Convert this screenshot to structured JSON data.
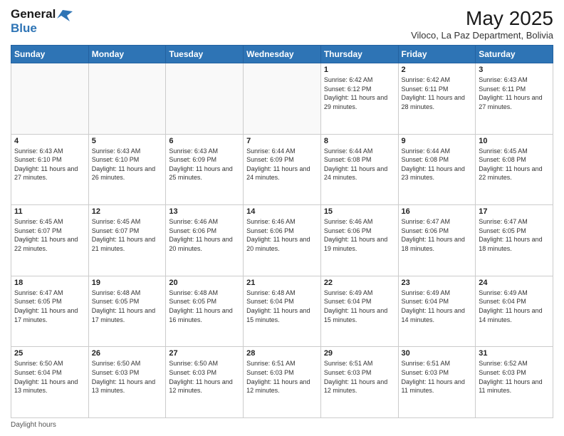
{
  "header": {
    "logo_line1": "General",
    "logo_line2": "Blue",
    "month": "May 2025",
    "location": "Viloco, La Paz Department, Bolivia"
  },
  "days_of_week": [
    "Sunday",
    "Monday",
    "Tuesday",
    "Wednesday",
    "Thursday",
    "Friday",
    "Saturday"
  ],
  "weeks": [
    [
      {
        "day": "",
        "info": ""
      },
      {
        "day": "",
        "info": ""
      },
      {
        "day": "",
        "info": ""
      },
      {
        "day": "",
        "info": ""
      },
      {
        "day": "1",
        "info": "Sunrise: 6:42 AM\nSunset: 6:12 PM\nDaylight: 11 hours and 29 minutes."
      },
      {
        "day": "2",
        "info": "Sunrise: 6:42 AM\nSunset: 6:11 PM\nDaylight: 11 hours and 28 minutes."
      },
      {
        "day": "3",
        "info": "Sunrise: 6:43 AM\nSunset: 6:11 PM\nDaylight: 11 hours and 27 minutes."
      }
    ],
    [
      {
        "day": "4",
        "info": "Sunrise: 6:43 AM\nSunset: 6:10 PM\nDaylight: 11 hours and 27 minutes."
      },
      {
        "day": "5",
        "info": "Sunrise: 6:43 AM\nSunset: 6:10 PM\nDaylight: 11 hours and 26 minutes."
      },
      {
        "day": "6",
        "info": "Sunrise: 6:43 AM\nSunset: 6:09 PM\nDaylight: 11 hours and 25 minutes."
      },
      {
        "day": "7",
        "info": "Sunrise: 6:44 AM\nSunset: 6:09 PM\nDaylight: 11 hours and 24 minutes."
      },
      {
        "day": "8",
        "info": "Sunrise: 6:44 AM\nSunset: 6:08 PM\nDaylight: 11 hours and 24 minutes."
      },
      {
        "day": "9",
        "info": "Sunrise: 6:44 AM\nSunset: 6:08 PM\nDaylight: 11 hours and 23 minutes."
      },
      {
        "day": "10",
        "info": "Sunrise: 6:45 AM\nSunset: 6:08 PM\nDaylight: 11 hours and 22 minutes."
      }
    ],
    [
      {
        "day": "11",
        "info": "Sunrise: 6:45 AM\nSunset: 6:07 PM\nDaylight: 11 hours and 22 minutes."
      },
      {
        "day": "12",
        "info": "Sunrise: 6:45 AM\nSunset: 6:07 PM\nDaylight: 11 hours and 21 minutes."
      },
      {
        "day": "13",
        "info": "Sunrise: 6:46 AM\nSunset: 6:06 PM\nDaylight: 11 hours and 20 minutes."
      },
      {
        "day": "14",
        "info": "Sunrise: 6:46 AM\nSunset: 6:06 PM\nDaylight: 11 hours and 20 minutes."
      },
      {
        "day": "15",
        "info": "Sunrise: 6:46 AM\nSunset: 6:06 PM\nDaylight: 11 hours and 19 minutes."
      },
      {
        "day": "16",
        "info": "Sunrise: 6:47 AM\nSunset: 6:06 PM\nDaylight: 11 hours and 18 minutes."
      },
      {
        "day": "17",
        "info": "Sunrise: 6:47 AM\nSunset: 6:05 PM\nDaylight: 11 hours and 18 minutes."
      }
    ],
    [
      {
        "day": "18",
        "info": "Sunrise: 6:47 AM\nSunset: 6:05 PM\nDaylight: 11 hours and 17 minutes."
      },
      {
        "day": "19",
        "info": "Sunrise: 6:48 AM\nSunset: 6:05 PM\nDaylight: 11 hours and 17 minutes."
      },
      {
        "day": "20",
        "info": "Sunrise: 6:48 AM\nSunset: 6:05 PM\nDaylight: 11 hours and 16 minutes."
      },
      {
        "day": "21",
        "info": "Sunrise: 6:48 AM\nSunset: 6:04 PM\nDaylight: 11 hours and 15 minutes."
      },
      {
        "day": "22",
        "info": "Sunrise: 6:49 AM\nSunset: 6:04 PM\nDaylight: 11 hours and 15 minutes."
      },
      {
        "day": "23",
        "info": "Sunrise: 6:49 AM\nSunset: 6:04 PM\nDaylight: 11 hours and 14 minutes."
      },
      {
        "day": "24",
        "info": "Sunrise: 6:49 AM\nSunset: 6:04 PM\nDaylight: 11 hours and 14 minutes."
      }
    ],
    [
      {
        "day": "25",
        "info": "Sunrise: 6:50 AM\nSunset: 6:04 PM\nDaylight: 11 hours and 13 minutes."
      },
      {
        "day": "26",
        "info": "Sunrise: 6:50 AM\nSunset: 6:03 PM\nDaylight: 11 hours and 13 minutes."
      },
      {
        "day": "27",
        "info": "Sunrise: 6:50 AM\nSunset: 6:03 PM\nDaylight: 11 hours and 12 minutes."
      },
      {
        "day": "28",
        "info": "Sunrise: 6:51 AM\nSunset: 6:03 PM\nDaylight: 11 hours and 12 minutes."
      },
      {
        "day": "29",
        "info": "Sunrise: 6:51 AM\nSunset: 6:03 PM\nDaylight: 11 hours and 12 minutes."
      },
      {
        "day": "30",
        "info": "Sunrise: 6:51 AM\nSunset: 6:03 PM\nDaylight: 11 hours and 11 minutes."
      },
      {
        "day": "31",
        "info": "Sunrise: 6:52 AM\nSunset: 6:03 PM\nDaylight: 11 hours and 11 minutes."
      }
    ]
  ],
  "footer": {
    "daylight_label": "Daylight hours"
  }
}
